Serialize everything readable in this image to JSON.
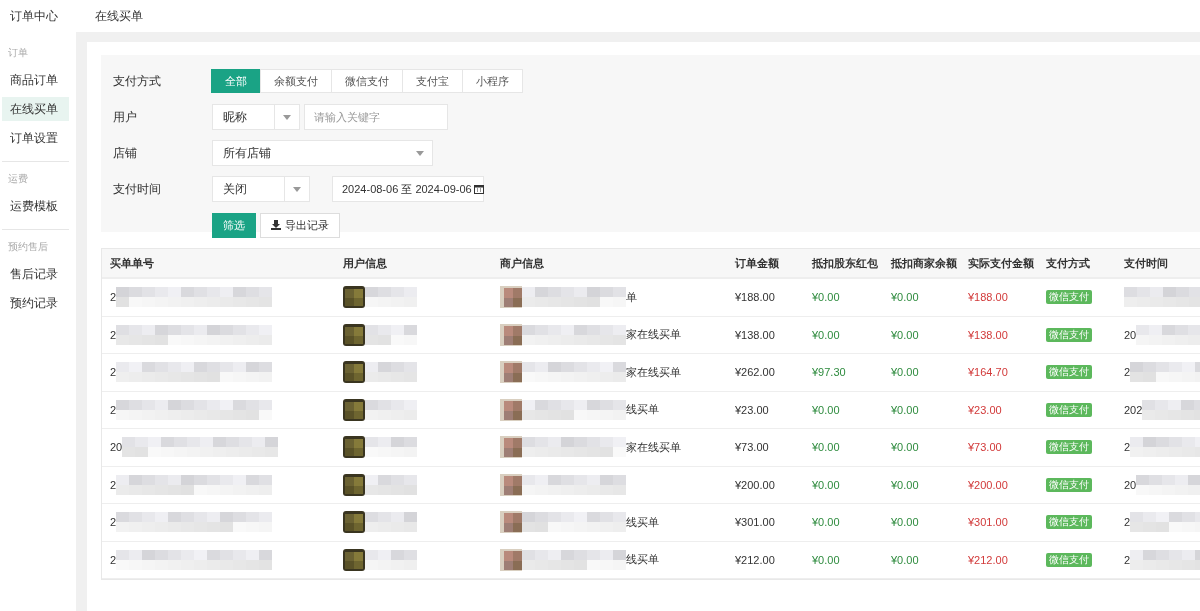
{
  "header": {
    "title": "订单中心",
    "page_title": "在线买单"
  },
  "sidebar": {
    "groups": [
      {
        "label": "订单",
        "items": [
          {
            "label": "商品订单",
            "selected": false
          },
          {
            "label": "在线买单",
            "selected": true
          },
          {
            "label": "订单设置",
            "selected": false
          }
        ]
      },
      {
        "label": "运费",
        "items": [
          {
            "label": "运费模板",
            "selected": false
          }
        ]
      },
      {
        "label": "预约售后",
        "items": [
          {
            "label": "售后记录",
            "selected": false
          },
          {
            "label": "预约记录",
            "selected": false
          }
        ]
      }
    ]
  },
  "filters": {
    "pay_method": {
      "label": "支付方式",
      "options": [
        {
          "label": "全部",
          "selected": true
        },
        {
          "label": "余额支付",
          "selected": false
        },
        {
          "label": "微信支付",
          "selected": false
        },
        {
          "label": "支付宝",
          "selected": false
        },
        {
          "label": "小程序",
          "selected": false
        }
      ]
    },
    "user": {
      "label": "用户",
      "select": "昵称",
      "placeholder": "请输入关键字"
    },
    "shop": {
      "label": "店铺",
      "select": "所有店铺"
    },
    "pay_time": {
      "label": "支付时间",
      "select": "关闭",
      "range": "2024-08-06 至 2024-09-06"
    },
    "buttons": [
      {
        "label": "筛选",
        "kind": "primary"
      },
      {
        "label": "导出记录",
        "kind": "export"
      }
    ]
  },
  "table": {
    "columns": [
      "买单单号",
      "用户信息",
      "商户信息",
      "订单金额",
      "抵扣股东红包",
      "抵扣商家余额",
      "实际支付金额",
      "支付方式",
      "支付时间"
    ],
    "rows": [
      {
        "order_no": "2",
        "merchant": "单",
        "amount": "¥188.00",
        "shareholder": "¥0.00",
        "balance": "¥0.00",
        "paid": "¥188.00",
        "method": "微信支付"
      },
      {
        "order_no": "2",
        "merchant": "家在线买单",
        "amount": "¥138.00",
        "shareholder": "¥0.00",
        "balance": "¥0.00",
        "paid": "¥138.00",
        "method": "微信支付",
        "time": "20"
      },
      {
        "order_no": "2",
        "merchant": "家在线买单",
        "amount": "¥262.00",
        "shareholder": "¥97.30",
        "balance": "¥0.00",
        "paid": "¥164.70",
        "method": "微信支付",
        "time": "2"
      },
      {
        "order_no": "2",
        "merchant": "线买单",
        "amount": "¥23.00",
        "shareholder": "¥0.00",
        "balance": "¥0.00",
        "paid": "¥23.00",
        "method": "微信支付",
        "time": "202"
      },
      {
        "order_no": "20",
        "merchant": "家在线买单",
        "amount": "¥73.00",
        "shareholder": "¥0.00",
        "balance": "¥0.00",
        "paid": "¥73.00",
        "method": "微信支付",
        "time": "2"
      },
      {
        "order_no": "2",
        "amount": "¥200.00",
        "shareholder": "¥0.00",
        "balance": "¥0.00",
        "paid": "¥200.00",
        "method": "微信支付",
        "time": "20"
      },
      {
        "order_no": "2",
        "merchant": "线买单",
        "amount": "¥301.00",
        "shareholder": "¥0.00",
        "balance": "¥0.00",
        "paid": "¥301.00",
        "method": "微信支付",
        "time": "2"
      },
      {
        "order_no": "2",
        "merchant": "线买单",
        "amount": "¥212.00",
        "shareholder": "¥0.00",
        "balance": "¥0.00",
        "paid": "¥212.00",
        "method": "微信支付",
        "time": "2"
      }
    ]
  }
}
